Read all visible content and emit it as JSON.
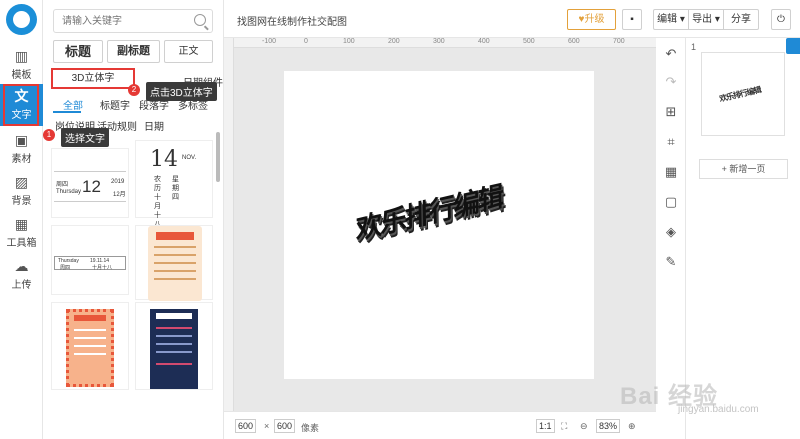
{
  "nav": {
    "items": [
      {
        "label": "模板",
        "icon": "template-icon"
      },
      {
        "label": "文字",
        "icon": "text-icon"
      },
      {
        "label": "素材",
        "icon": "image-icon"
      },
      {
        "label": "背景",
        "icon": "background-icon"
      },
      {
        "label": "工具箱",
        "icon": "toolbox-icon"
      },
      {
        "label": "上传",
        "icon": "upload-icon"
      }
    ]
  },
  "panel": {
    "search_placeholder": "请输入关键字",
    "title_buttons": [
      "标题",
      "副标题",
      "正文"
    ],
    "tabs": [
      "3D立体字",
      "日期组件"
    ],
    "subtabs": [
      "全部",
      "标题字",
      "段落字",
      "多标签",
      "岗位说明",
      "活动规则",
      "日期"
    ],
    "cards": {
      "date1": {
        "weekday_cn": "周四",
        "weekday_en": "Thursday",
        "day": "12",
        "year": "2019",
        "month": "12月"
      },
      "date2": {
        "day": "14",
        "month_en": "NOV.",
        "weekday": "星期四",
        "lunar": "农历 十月 十八"
      },
      "date3": {
        "weekday_en": "Thursday",
        "weekday_cn": "周四",
        "date": "19.11.14",
        "lunar": "十月十八"
      }
    }
  },
  "steps": [
    {
      "num": "1",
      "tip": "选择文字"
    },
    {
      "num": "2",
      "tip": "点击3D立体字"
    }
  ],
  "header": {
    "doc_title": "找图网在线制作社交配图",
    "upgrade": "♥升级",
    "menu": [
      "编辑 ▾",
      "导出 ▾",
      "分享"
    ]
  },
  "ruler": {
    "ticks": [
      "-100",
      "0",
      "100",
      "200",
      "300",
      "400",
      "500",
      "600",
      "700"
    ]
  },
  "canvas": {
    "art_text": "欢乐排行编辑"
  },
  "footer": {
    "width": "600",
    "times": "×",
    "height": "600",
    "unit": "像素",
    "ratio": "1:1",
    "zoom": "83%"
  },
  "pages": {
    "page_num": "1",
    "add_page": "+ 新增一页"
  },
  "watermark": {
    "brand": "Bai 经验",
    "url": "jingyan.baidu.com"
  },
  "colors": {
    "accent": "#1f8ad6",
    "highlight": "#e53935",
    "upgrade": "#e3a13b"
  }
}
